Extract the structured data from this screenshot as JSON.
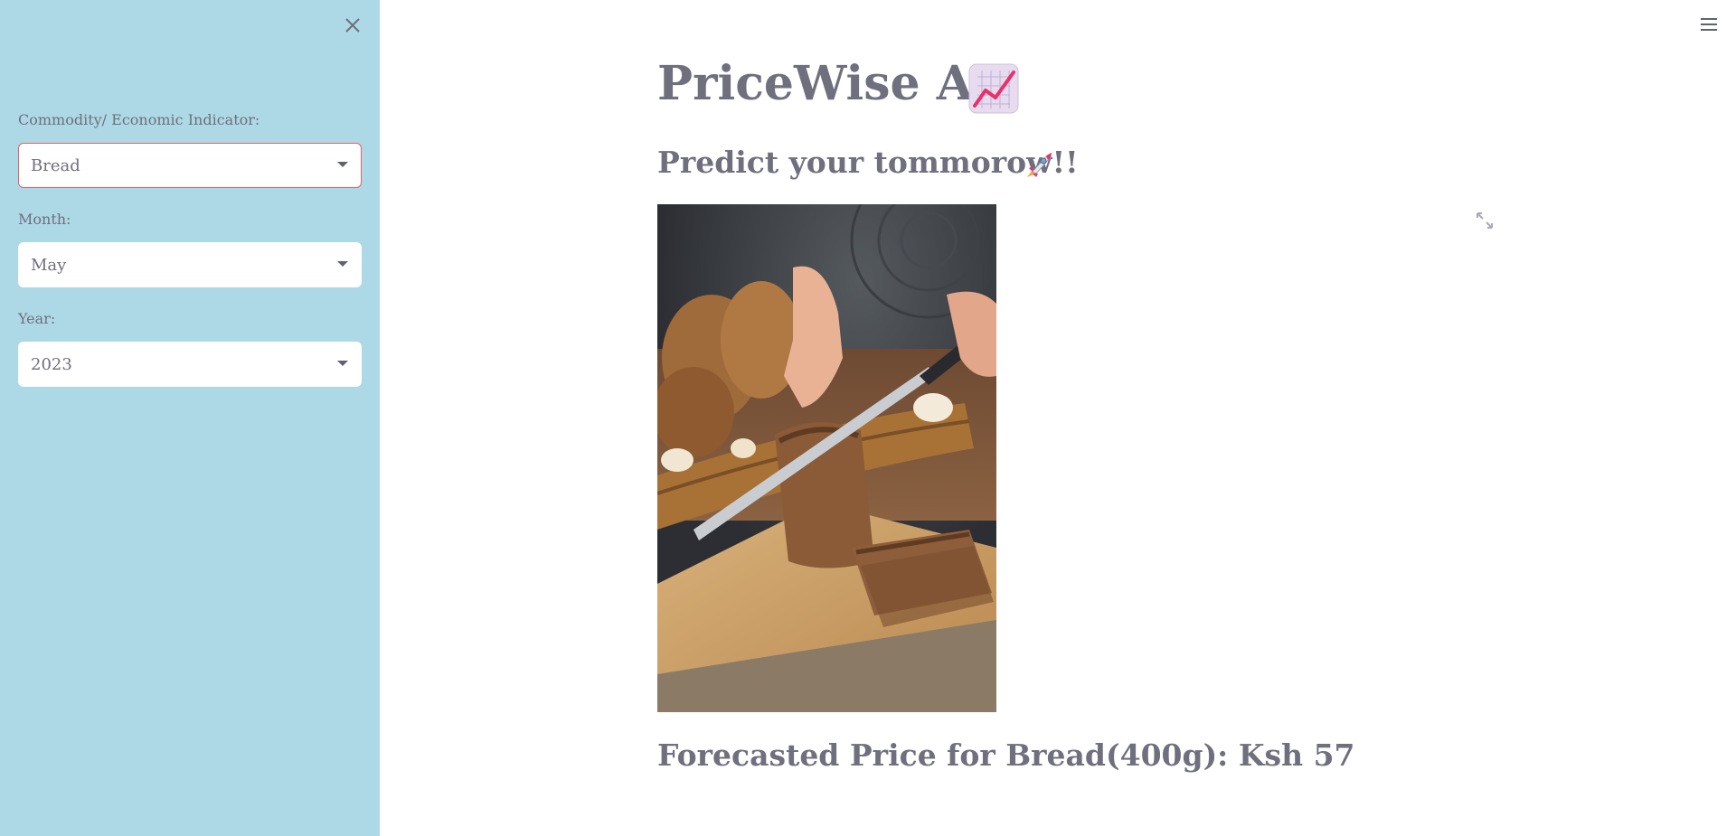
{
  "sidebar": {
    "commodity_label": "Commodity/ Economic Indicator:",
    "commodity_value": "Bread",
    "month_label": "Month:",
    "month_value": "May",
    "year_label": "Year:",
    "year_value": "2023",
    "close_icon": "close-icon"
  },
  "header": {
    "title": "PriceWise AI",
    "title_icon": "chart-increasing-icon",
    "menu_icon": "hamburger-menu-icon"
  },
  "main": {
    "subtitle": "Predict your tommorow!!",
    "subtitle_icon": "rocket-icon",
    "image_alt": "bread-slicing-photo",
    "forecast_text": "Forecasted Price for Bread(400g): Ksh 57"
  },
  "colors": {
    "sidebar_bg": "#add8e6",
    "text": "#6f6f7e",
    "focus_border": "#e0626b"
  }
}
